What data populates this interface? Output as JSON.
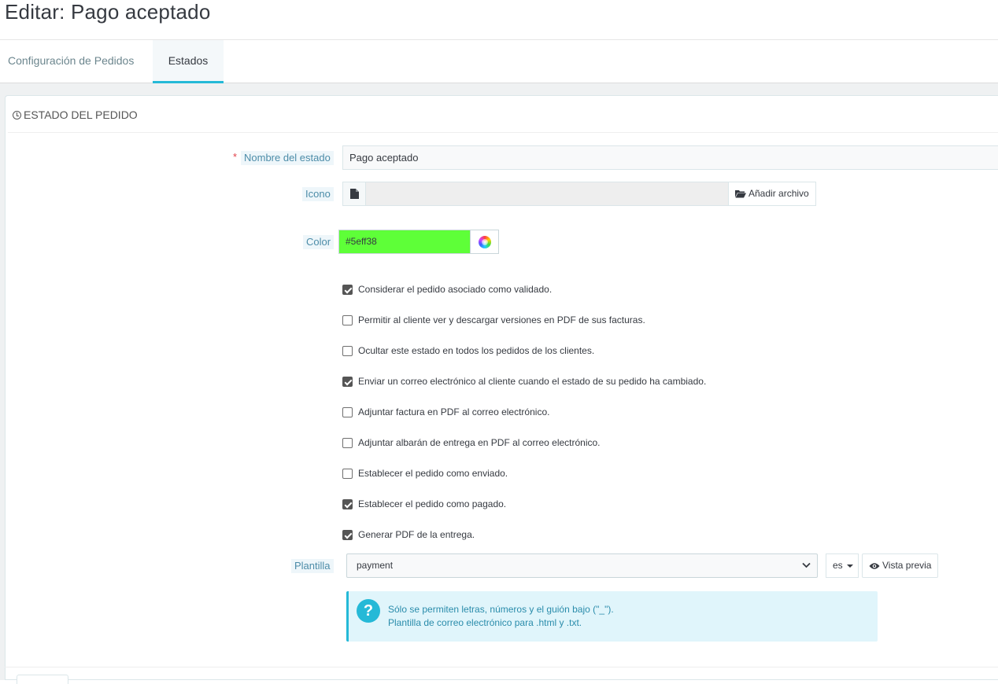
{
  "page": {
    "title": "Editar: Pago aceptado"
  },
  "tabs": [
    {
      "label": "Configuración de Pedidos",
      "active": false
    },
    {
      "label": "Estados",
      "active": true
    }
  ],
  "panel": {
    "heading": "ESTADO DEL PEDIDO",
    "heading_icon": "clock-icon"
  },
  "form": {
    "name": {
      "label": "Nombre del estado",
      "required_mark": "*",
      "value": "Pago aceptado"
    },
    "icon": {
      "label": "Icono",
      "file_value": "",
      "button_label": "Añadir archivo"
    },
    "color": {
      "label": "Color",
      "value": "#5eff38",
      "swatch": "#5eff38"
    },
    "checkboxes": [
      {
        "label": "Considerar el pedido asociado como validado.",
        "checked": true
      },
      {
        "label": "Permitir al cliente ver y descargar versiones en PDF de sus facturas.",
        "checked": false
      },
      {
        "label": "Ocultar este estado en todos los pedidos de los clientes.",
        "checked": false
      },
      {
        "label": "Enviar un correo electrónico al cliente cuando el estado de su pedido ha cambiado.",
        "checked": true
      },
      {
        "label": "Adjuntar factura en PDF al correo electrónico.",
        "checked": false
      },
      {
        "label": "Adjuntar albarán de entrega en PDF al correo electrónico.",
        "checked": false
      },
      {
        "label": "Establecer el pedido como enviado.",
        "checked": false
      },
      {
        "label": "Establecer el pedido como pagado.",
        "checked": true
      },
      {
        "label": "Generar PDF de la entrega.",
        "checked": true
      }
    ],
    "template": {
      "label": "Plantilla",
      "selected": "payment",
      "language": "es",
      "preview_label": "Vista previa"
    },
    "info": {
      "line1": "Sólo se permiten letras, números y el guión bajo (\"_\").",
      "line2": "Plantilla de correo electrónico para .html y .txt."
    }
  },
  "colors": {
    "accent": "#25b9d7",
    "label_text": "#4c8ca8",
    "required": "#e2424b",
    "info_bg": "#e0f5fb"
  }
}
